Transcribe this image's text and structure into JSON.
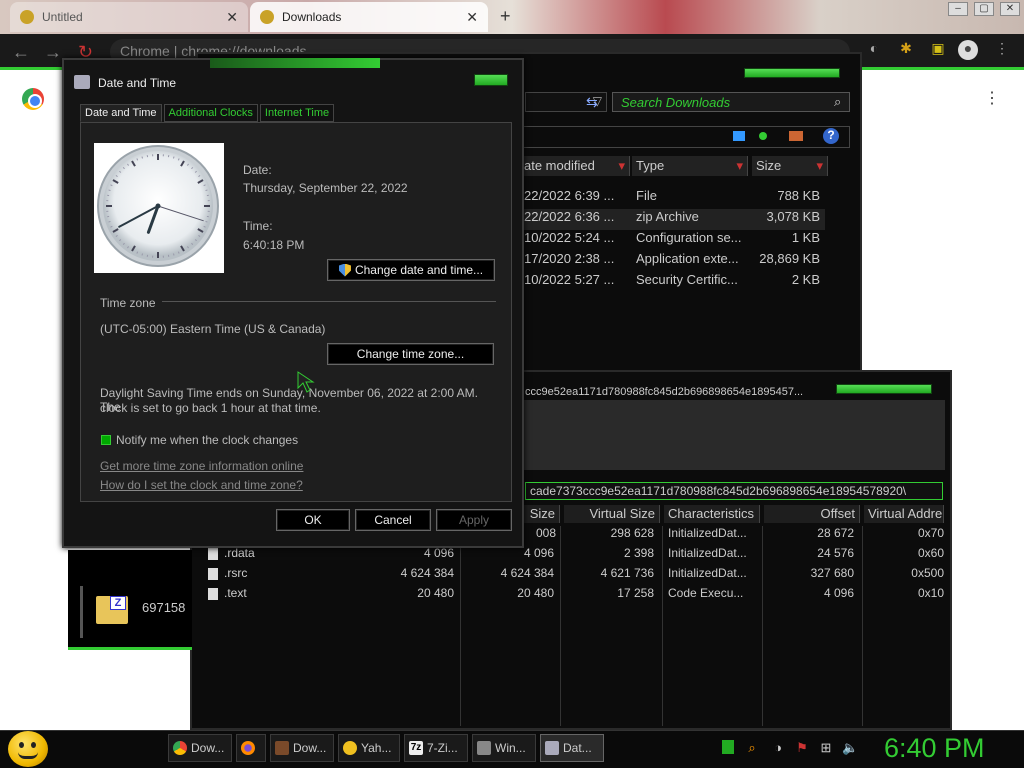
{
  "browser": {
    "tabs": [
      {
        "label": "Untitled",
        "close": "✕"
      },
      {
        "label": "Downloads",
        "close": "✕"
      }
    ],
    "new_tab": "+",
    "omnibox": {
      "site": "Chrome",
      "url": "chrome://downloads"
    }
  },
  "downloads_window": {
    "search_placeholder": "Search Downloads",
    "columns": [
      "ate modified",
      "Type",
      "Size"
    ],
    "rows": [
      {
        "date": "22/2022 6:39 ...",
        "type": "File",
        "size": "788 KB"
      },
      {
        "date": "22/2022 6:36 ...",
        "type": "zip Archive",
        "size": "3,078 KB"
      },
      {
        "date": "10/2022 5:24 ...",
        "type": "Configuration se...",
        "size": "1 KB"
      },
      {
        "date": "17/2020 2:38 ...",
        "type": "Application exte...",
        "size": "28,869 KB"
      },
      {
        "date": "10/2022 5:27 ...",
        "type": "Security Certific...",
        "size": "2 KB"
      }
    ]
  },
  "pe_window": {
    "title": "ccc9e52ea1171d780988fc845d2b696898654e1895457...",
    "address": "cade7373ccc9e52ea1171d780988fc845d2b696898654e18954578920\\",
    "columns": [
      "Size",
      "Virtual Size",
      "Characteristics",
      "Offset",
      "Virtual Addre"
    ],
    "rows": [
      {
        "name": "",
        "raw": "",
        "size": "008",
        "vsize": "298 628",
        "chars": "InitializedDat...",
        "offset": "28 672",
        "vaddr": "0x70"
      },
      {
        "name": ".rdata",
        "raw": "4 096",
        "size": "4 096",
        "vsize": "2 398",
        "chars": "InitializedDat...",
        "offset": "24 576",
        "vaddr": "0x60"
      },
      {
        "name": ".rsrc",
        "raw": "4 624 384",
        "size": "4 624 384",
        "vsize": "4 621 736",
        "chars": "InitializedDat...",
        "offset": "327 680",
        "vaddr": "0x500"
      },
      {
        "name": ".text",
        "raw": "20 480",
        "size": "20 480",
        "vsize": "17 258",
        "chars": "Code Execu...",
        "offset": "4 096",
        "vaddr": "0x10"
      }
    ],
    "file_label": "697158"
  },
  "dialog": {
    "title": "Date and Time",
    "tabs": [
      "Date and Time",
      "Additional Clocks",
      "Internet Time"
    ],
    "date_label": "Date:",
    "date_value": "Thursday, September 22, 2022",
    "time_label": "Time:",
    "time_value": "6:40:18 PM",
    "change_dt_button": "Change date and time...",
    "timezone_heading": "Time zone",
    "timezone_value": "(UTC-05:00) Eastern Time (US & Canada)",
    "change_tz_button": "Change time zone...",
    "dst_line1": "Daylight Saving Time ends on Sunday, November 06, 2022 at 2:00 AM. The",
    "dst_line2": "clock is set to go back 1 hour at that time.",
    "notify_checkbox": "Notify me when the clock changes",
    "link1": "Get more time zone information online",
    "link2": "How do I set the clock and time zone?",
    "ok": "OK",
    "cancel": "Cancel",
    "apply": "Apply",
    "clock": {
      "hour": 6,
      "minute": 40,
      "second": 18
    }
  },
  "taskbar": {
    "items": [
      {
        "label": "Dow...",
        "icon": "chrome-icon"
      },
      {
        "label": "",
        "icon": "firefox-icon"
      },
      {
        "label": "Dow...",
        "icon": "app-icon"
      },
      {
        "label": "Yah...",
        "icon": "yahoo-icon"
      },
      {
        "label": "7-Zi...",
        "icon": "7zip-icon"
      },
      {
        "label": "Win...",
        "icon": "window-icon"
      },
      {
        "label": "Dat...",
        "icon": "clock-icon"
      }
    ],
    "time": "6:40 PM"
  },
  "colors": {
    "accent": "#33cc33",
    "dark": "#0c0c0c"
  }
}
